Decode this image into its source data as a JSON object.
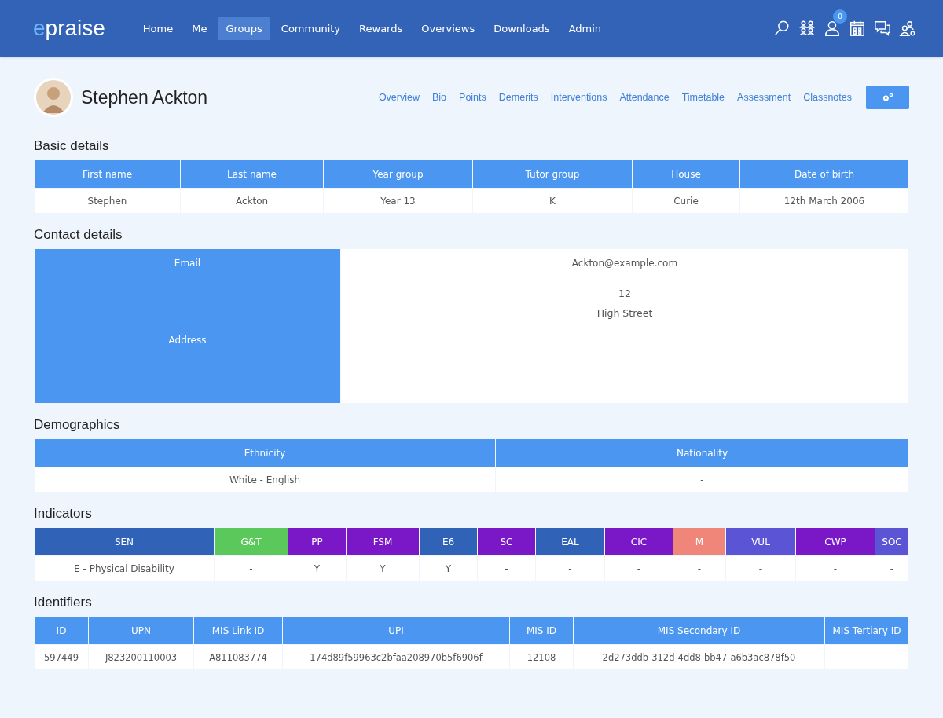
{
  "header": {
    "logo": {
      "mark": "e",
      "text": "praise"
    },
    "nav": [
      {
        "label": "Home",
        "selected": false
      },
      {
        "label": "Me",
        "selected": false
      },
      {
        "label": "Groups",
        "selected": true
      },
      {
        "label": "Community",
        "selected": false
      },
      {
        "label": "Rewards",
        "selected": false
      },
      {
        "label": "Overviews",
        "selected": false
      },
      {
        "label": "Downloads",
        "selected": false
      },
      {
        "label": "Admin",
        "selected": false
      }
    ],
    "notification_count": "0"
  },
  "profile": {
    "name": "Stephen Ackton",
    "tabs": [
      {
        "label": "Overview",
        "selected": false
      },
      {
        "label": "Bio",
        "selected": false
      },
      {
        "label": "Points",
        "selected": false
      },
      {
        "label": "Demerits",
        "selected": false
      },
      {
        "label": "Interventions",
        "selected": false
      },
      {
        "label": "Attendance",
        "selected": false
      },
      {
        "label": "Timetable",
        "selected": false
      },
      {
        "label": "Assessment",
        "selected": false
      },
      {
        "label": "Classnotes",
        "selected": false
      }
    ]
  },
  "basic_details": {
    "title": "Basic details",
    "columns": [
      "First name",
      "Last name",
      "Year group",
      "Tutor group",
      "House",
      "Date of birth"
    ],
    "values": [
      "Stephen",
      "Ackton",
      "Year 13",
      "K",
      "Curie",
      "12th March 2006"
    ]
  },
  "contact_details": {
    "title": "Contact details",
    "email_label": "Email",
    "email": "Ackton@example.com",
    "address_label": "Address",
    "address_lines": [
      "12",
      "High Street"
    ]
  },
  "demographics": {
    "title": "Demographics",
    "columns": [
      "Ethnicity",
      "Nationality"
    ],
    "values": [
      "White - English",
      "-"
    ]
  },
  "indicators": {
    "title": "Indicators",
    "items": [
      {
        "label": "SEN",
        "value": "E - Physical Disability",
        "color": "#3063b8"
      },
      {
        "label": "G&T",
        "value": "-",
        "color": "#5ac85a"
      },
      {
        "label": "PP",
        "value": "Y",
        "color": "#7a17c7"
      },
      {
        "label": "FSM",
        "value": "Y",
        "color": "#7a17c7"
      },
      {
        "label": "E6",
        "value": "Y",
        "color": "#3063b8"
      },
      {
        "label": "SC",
        "value": "-",
        "color": "#7a17c7"
      },
      {
        "label": "EAL",
        "value": "-",
        "color": "#3063b8"
      },
      {
        "label": "CIC",
        "value": "-",
        "color": "#7a17c7"
      },
      {
        "label": "M",
        "value": "-",
        "color": "#f0857a"
      },
      {
        "label": "VUL",
        "value": "-",
        "color": "#5b55d6"
      },
      {
        "label": "CWP",
        "value": "-",
        "color": "#7a17c7"
      },
      {
        "label": "SOC",
        "value": "-",
        "color": "#5b55d6"
      }
    ]
  },
  "identifiers": {
    "title": "Identifiers",
    "columns": [
      "ID",
      "UPN",
      "MIS Link ID",
      "UPI",
      "MIS ID",
      "MIS Secondary ID",
      "MIS Tertiary ID"
    ],
    "values": [
      "597449",
      "J823200110003",
      "A811083774",
      "174d89f59963c2bfaa208970b5f6906f",
      "12108",
      "2d273ddb-312d-4dd8-bb47-a6b3ac878f50",
      "-"
    ]
  }
}
